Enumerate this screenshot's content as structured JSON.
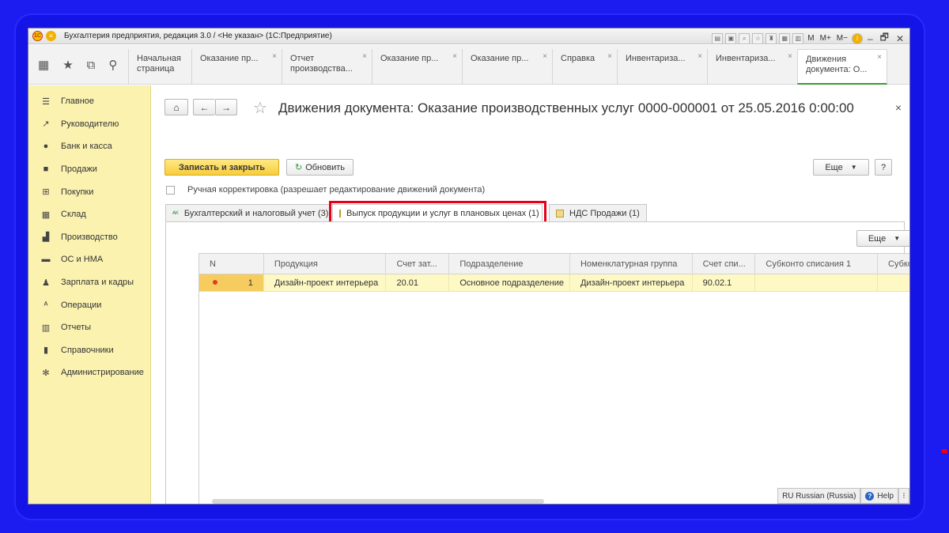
{
  "app": {
    "title": "Бухгалтерия предприятия, редакция 3.0 / <Не указан>  (1С:Предприятие)",
    "logo_text": "1С",
    "menu_glyph": "≡",
    "user_buttons": [
      "M",
      "M+",
      "M−"
    ],
    "window_controls": [
      "–",
      "🗗",
      "✕"
    ]
  },
  "toolbar_icons": [
    "grid-icon",
    "star-icon",
    "history-icon",
    "search-icon"
  ],
  "tabs": [
    {
      "line1": "Начальная",
      "line2": "страница",
      "closable": false
    },
    {
      "line1": "Оказание пр...",
      "line2": "",
      "closable": true
    },
    {
      "line1": "Отчет",
      "line2": "производства...",
      "closable": true
    },
    {
      "line1": "Оказание пр...",
      "line2": "",
      "closable": true
    },
    {
      "line1": "Оказание пр...",
      "line2": "",
      "closable": true
    },
    {
      "line1": "Справка",
      "line2": "",
      "closable": true
    },
    {
      "line1": "Инвентариза...",
      "line2": "",
      "closable": true
    },
    {
      "line1": "Инвентариза...",
      "line2": "",
      "closable": true
    },
    {
      "line1": "Движения",
      "line2": "документа: О...",
      "closable": true,
      "active": true
    }
  ],
  "sidebar": {
    "items": [
      {
        "label": "Главное",
        "icon": "menu-icon"
      },
      {
        "label": "Руководителю",
        "icon": "trend-icon"
      },
      {
        "label": "Банк и касса",
        "icon": "coin-icon"
      },
      {
        "label": "Продажи",
        "icon": "bag-icon"
      },
      {
        "label": "Покупки",
        "icon": "cart-icon"
      },
      {
        "label": "Склад",
        "icon": "warehouse-icon"
      },
      {
        "label": "Производство",
        "icon": "factory-icon"
      },
      {
        "label": "ОС и НМА",
        "icon": "truck-icon"
      },
      {
        "label": "Зарплата и кадры",
        "icon": "person-icon"
      },
      {
        "label": "Операции",
        "icon": "operations-icon"
      },
      {
        "label": "Отчеты",
        "icon": "chart-icon"
      },
      {
        "label": "Справочники",
        "icon": "book-icon"
      },
      {
        "label": "Администрирование",
        "icon": "gear-icon"
      }
    ]
  },
  "page": {
    "title": "Движения документа: Оказание производственных услуг 0000-000001 от 25.05.2016 0:00:00",
    "close": "×",
    "save_close_label": "Записать и закрыть",
    "refresh_label": "Обновить",
    "more_label": "Еще",
    "help_label": "?",
    "manual_edit_label": "Ручная корректировка (разрешает редактирование движений документа)",
    "manual_edit_checked": false
  },
  "form_tabs": [
    {
      "label": "Бухгалтерский и налоговый учет (3)",
      "selected": false
    },
    {
      "label": "Выпуск продукции и услуг в плановых ценах (1)",
      "selected": true,
      "highlighted": true
    },
    {
      "label": "НДС Продажи (1)",
      "selected": false
    }
  ],
  "table": {
    "more_label": "Еще",
    "columns": [
      "N",
      "Продукция",
      "Счет зат...",
      "Подразделение",
      "Номенклатурная группа",
      "Счет спи...",
      "Субконто списания 1",
      "Субко"
    ],
    "rows": [
      [
        "1",
        "Дизайн-проект интерьера",
        "20.01",
        "Основное подразделение",
        "Дизайн-проект интерьера",
        "90.02.1",
        "",
        ""
      ]
    ]
  },
  "statusbar": {
    "language": "RU Russian (Russia)",
    "help": "Help"
  },
  "colors": {
    "background": "#1c1cf0",
    "sidebar": "#fbf2b0",
    "primary_button": "#f7cd3c",
    "highlight": "#e6001a",
    "selected_row": "#fdf8c4"
  }
}
